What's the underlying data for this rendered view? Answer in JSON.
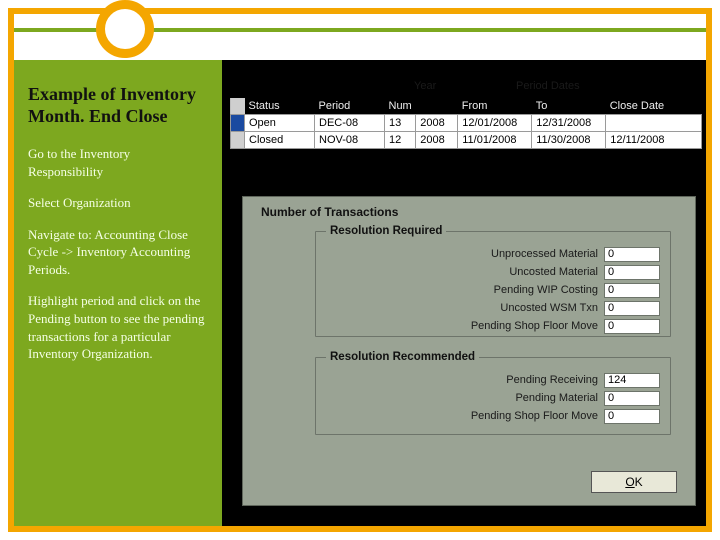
{
  "sidebar": {
    "title": "Example of Inventory Month. End Close",
    "p1": "Go to the Inventory Responsibility",
    "p2": "Select Organization",
    "p3": "Navigate to: Accounting Close Cycle -> Inventory Accounting Periods.",
    "p4": "Highlight period and click on the Pending button to see the pending transactions for a particular Inventory Organization."
  },
  "periods": {
    "label_year": "Year",
    "label_period_dates": "Period Dates",
    "headers": {
      "status": "Status",
      "period": "Period",
      "num": "Num",
      "year": "",
      "from": "From",
      "to": "To",
      "close_date": "Close Date"
    },
    "rows": [
      {
        "selected": true,
        "status": "Open",
        "period": "DEC-08",
        "num": "13",
        "year": "2008",
        "from": "12/01/2008",
        "to": "12/31/2008",
        "close": ""
      },
      {
        "selected": false,
        "status": "Closed",
        "period": "NOV-08",
        "num": "12",
        "year": "2008",
        "from": "11/01/2008",
        "to": "11/30/2008",
        "close": "12/11/2008"
      }
    ]
  },
  "dialog": {
    "title": "Number of Transactions",
    "group_required": "Resolution Required",
    "group_recommended": "Resolution Recommended",
    "required": {
      "unprocessed_material_label": "Unprocessed Material",
      "unprocessed_material_value": "0",
      "uncosted_material_label": "Uncosted Material",
      "uncosted_material_value": "0",
      "pending_wip_label": "Pending WIP Costing",
      "pending_wip_value": "0",
      "uncosted_wsm_label": "Uncosted WSM Txn",
      "uncosted_wsm_value": "0",
      "pending_shop_label": "Pending Shop Floor Move",
      "pending_shop_value": "0"
    },
    "recommended": {
      "pending_receiving_label": "Pending Receiving",
      "pending_receiving_value": "124",
      "pending_material_label": "Pending Material",
      "pending_material_value": "0",
      "pending_shop_label": "Pending Shop Floor Move",
      "pending_shop_value": "0"
    },
    "ok_label": "OK"
  }
}
